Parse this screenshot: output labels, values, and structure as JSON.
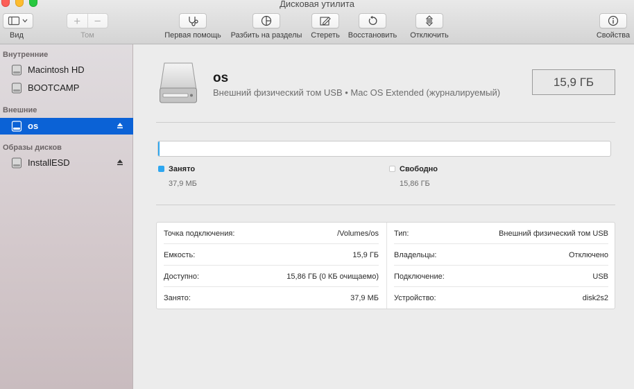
{
  "window": {
    "title": "Дисковая утилита"
  },
  "toolbar": {
    "view_label": "Вид",
    "volume_label": "Том",
    "first_aid_label": "Первая помощь",
    "partition_label": "Разбить на разделы",
    "erase_label": "Стереть",
    "restore_label": "Восстановить",
    "unmount_label": "Отключить",
    "info_label": "Свойства"
  },
  "sidebar": {
    "sections": [
      {
        "title": "Внутренние",
        "items": [
          {
            "label": "Macintosh HD"
          },
          {
            "label": "BOOTCAMP"
          }
        ]
      },
      {
        "title": "Внешние",
        "items": [
          {
            "label": "os",
            "selected": true
          }
        ]
      },
      {
        "title": "Образы дисков",
        "items": [
          {
            "label": "InstallESD"
          }
        ]
      }
    ]
  },
  "volume": {
    "name": "os",
    "description": "Внешний физический том USB • Mac OS Extended (журналируемый)",
    "size": "15,9 ГБ",
    "used_fraction": 0.003
  },
  "usage": {
    "used_label": "Занято",
    "used_value": "37,9 МБ",
    "used_color": "#2ea7f0",
    "free_label": "Свободно",
    "free_value": "15,86 ГБ",
    "free_color": "#ffffff"
  },
  "details": {
    "left": [
      {
        "key": "Точка подключения:",
        "value": "/Volumes/os"
      },
      {
        "key": "Емкость:",
        "value": "15,9 ГБ"
      },
      {
        "key": "Доступно:",
        "value": "15,86 ГБ (0 КБ очищаемо)"
      },
      {
        "key": "Занято:",
        "value": "37,9 МБ"
      }
    ],
    "right": [
      {
        "key": "Тип:",
        "value": "Внешний физический том USB"
      },
      {
        "key": "Владельцы:",
        "value": "Отключено"
      },
      {
        "key": "Подключение:",
        "value": "USB"
      },
      {
        "key": "Устройство:",
        "value": "disk2s2"
      }
    ]
  },
  "colors": {
    "selection": "#0b62d6",
    "accent_used": "#2ea7f0"
  }
}
